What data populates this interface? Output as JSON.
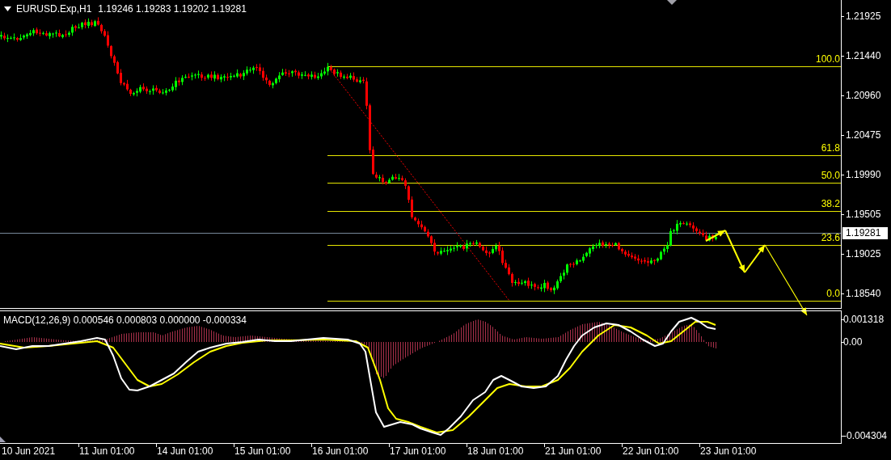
{
  "chart": {
    "symbol": "EURUSD.Exp,H1",
    "quote": "1.19246 1.19283 1.19202 1.19281"
  },
  "price_axis": {
    "labels": [
      "1.21925",
      "1.21440",
      "1.20960",
      "1.20475",
      "1.19990",
      "1.19505",
      "1.19025",
      "1.18540"
    ],
    "current_price": "1.19281"
  },
  "fibonacci": {
    "levels": [
      "100.0",
      "61.8",
      "50.0",
      "38.2",
      "23.6",
      "0.0"
    ]
  },
  "macd": {
    "label": "MACD(12,26,9) 0.000546 0.000803 0.000000 -0.000334",
    "axis_labels": [
      "0.001318",
      "0.00",
      "-0.004304"
    ]
  },
  "time_axis": {
    "labels": [
      "10 Jun 2021",
      "11 Jun 01:00",
      "14 Jun 01:00",
      "15 Jun 01:00",
      "16 Jun 01:00",
      "17 Jun 01:00",
      "18 Jun 01:00",
      "21 Jun 01:00",
      "22 Jun 01:00",
      "23 Jun 01:00"
    ]
  }
}
